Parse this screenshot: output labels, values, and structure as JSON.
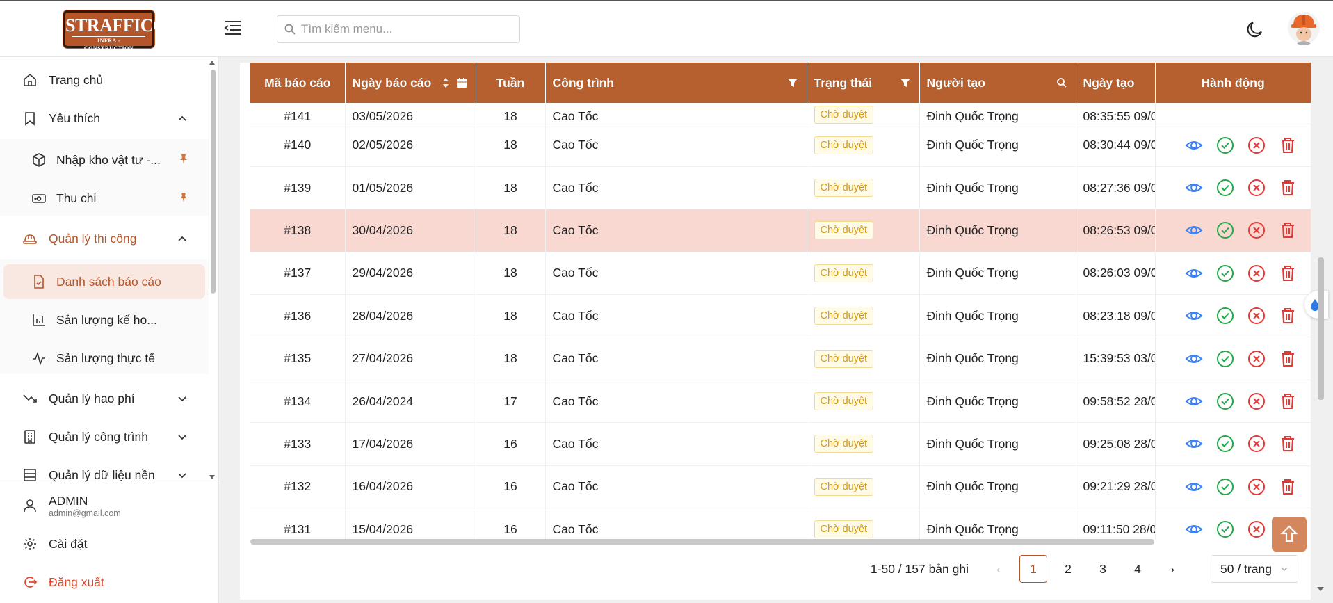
{
  "brand": {
    "logo_line1": "STRAFFICO",
    "logo_line2": "INFRA - CONSTRUCTION",
    "accent": "#b5562a"
  },
  "search": {
    "placeholder": "Tìm kiếm menu..."
  },
  "sidebar": {
    "home": "Trang chủ",
    "favorites": "Yêu thích",
    "fav_items": [
      "Nhập kho vật tư -...",
      "Thu chi"
    ],
    "construction": "Quản lý thi công",
    "construction_items": [
      "Danh sách báo cáo",
      "Sản lượng kế ho...",
      "Sản lượng thực tế"
    ],
    "cost": "Quản lý hao phí",
    "projects": "Quản lý công trình",
    "basedata": "Quản lý dữ liệu nền",
    "user_name": "ADMIN",
    "user_email": "admin@gmail.com",
    "settings": "Cài đặt",
    "logout": "Đăng xuất"
  },
  "table": {
    "columns": [
      "Mã báo cáo",
      "Ngày báo cáo",
      "Tuần",
      "Công trình",
      "Trạng thái",
      "Người tạo",
      "Ngày tạo",
      "Hành động"
    ],
    "top_partial": {
      "id": "#141",
      "date": "03/05/2026",
      "week": "18",
      "project": "Cao Tốc",
      "status": "Chờ duyệt",
      "creator": "Đinh Quốc Trọng",
      "created": "08:35:55 09/0"
    },
    "rows": [
      {
        "id": "#140",
        "date": "02/05/2026",
        "week": "18",
        "project": "Cao Tốc",
        "status": "Chờ duyệt",
        "creator": "Đinh Quốc Trọng",
        "created": "08:30:44 09/0"
      },
      {
        "id": "#139",
        "date": "01/05/2026",
        "week": "18",
        "project": "Cao Tốc",
        "status": "Chờ duyệt",
        "creator": "Đinh Quốc Trọng",
        "created": "08:27:36 09/0"
      },
      {
        "id": "#138",
        "date": "30/04/2026",
        "week": "18",
        "project": "Cao Tốc",
        "status": "Chờ duyệt",
        "creator": "Đinh Quốc Trọng",
        "created": "08:26:53 09/0"
      },
      {
        "id": "#137",
        "date": "29/04/2026",
        "week": "18",
        "project": "Cao Tốc",
        "status": "Chờ duyệt",
        "creator": "Đinh Quốc Trọng",
        "created": "08:26:03 09/0"
      },
      {
        "id": "#136",
        "date": "28/04/2026",
        "week": "18",
        "project": "Cao Tốc",
        "status": "Chờ duyệt",
        "creator": "Đinh Quốc Trọng",
        "created": "08:23:18 09/0"
      },
      {
        "id": "#135",
        "date": "27/04/2026",
        "week": "18",
        "project": "Cao Tốc",
        "status": "Chờ duyệt",
        "creator": "Đinh Quốc Trọng",
        "created": "15:39:53 03/0"
      },
      {
        "id": "#134",
        "date": "26/04/2024",
        "week": "17",
        "project": "Cao Tốc",
        "status": "Chờ duyệt",
        "creator": "Đinh Quốc Trọng",
        "created": "09:58:52 28/0"
      },
      {
        "id": "#133",
        "date": "17/04/2026",
        "week": "16",
        "project": "Cao Tốc",
        "status": "Chờ duyệt",
        "creator": "Đinh Quốc Trọng",
        "created": "09:25:08 28/0"
      },
      {
        "id": "#132",
        "date": "16/04/2026",
        "week": "16",
        "project": "Cao Tốc",
        "status": "Chờ duyệt",
        "creator": "Đinh Quốc Trọng",
        "created": "09:21:29 28/0"
      },
      {
        "id": "#131",
        "date": "15/04/2026",
        "week": "16",
        "project": "Cao Tốc",
        "status": "Chờ duyệt",
        "creator": "Đinh Quốc Trọng",
        "created": "09:11:50 28/0"
      }
    ],
    "highlighted_row": "#138"
  },
  "pagination": {
    "total": "1-50 / 157 bản ghi",
    "pages": [
      "1",
      "2",
      "3",
      "4"
    ],
    "current": "1",
    "page_size": "50 / trang"
  },
  "colors": {
    "header_bg": "#b5602e",
    "highlight_row": "#f8d8d0",
    "badge_text": "#d49b16",
    "view": "#3b82f6",
    "approve": "#22a846",
    "reject": "#e53935",
    "delete": "#e53935"
  }
}
